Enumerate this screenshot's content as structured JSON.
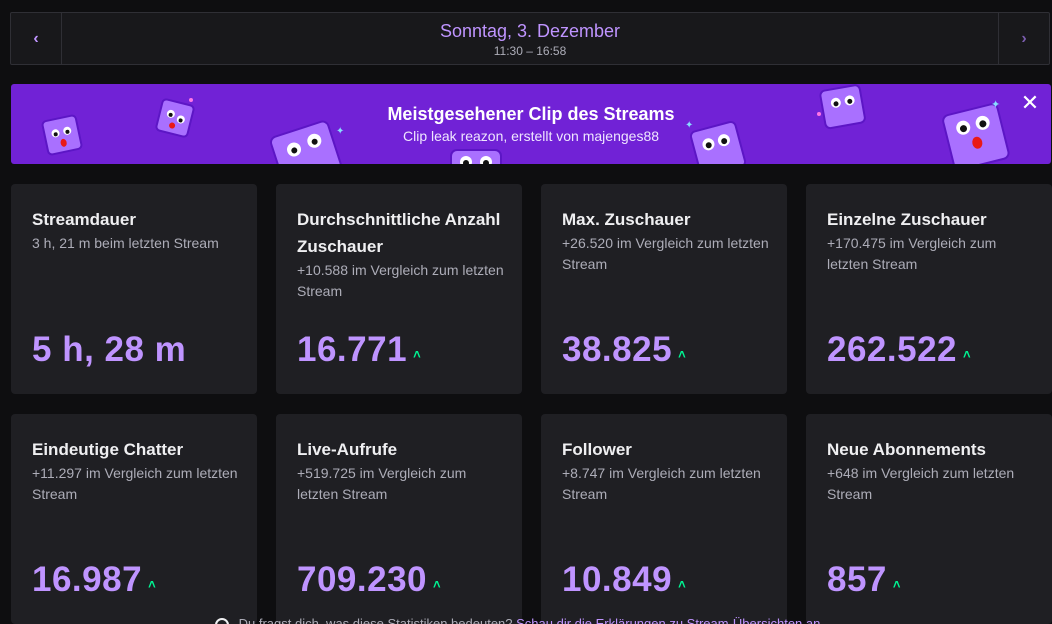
{
  "header": {
    "prev_icon": "chevron-left-icon",
    "next_icon": "chevron-right-icon",
    "prev_glyph": "‹",
    "next_glyph": "›",
    "date": "Sonntag, 3. Dezember",
    "time_range": "11:30 – 16:58"
  },
  "banner": {
    "title": "Meistgesehener Clip des Streams",
    "subtitle": "Clip leak reazon, erstellt von majenges88",
    "close_glyph": "✕",
    "background": "#7122d6"
  },
  "cards": [
    {
      "title": "Streamdauer",
      "subtitle": "3 h, 21 m beim letzten Stream",
      "value": "5 h, 28 m",
      "trend": ""
    },
    {
      "title": "Durchschnittliche Anzahl Zuschauer",
      "subtitle": "+10.588 im Vergleich zum letzten Stream",
      "value": "16.771",
      "trend": "˄"
    },
    {
      "title": "Max. Zuschauer",
      "subtitle": "+26.520 im Vergleich zum letzten Stream",
      "value": "38.825",
      "trend": "˄"
    },
    {
      "title": "Einzelne Zuschauer",
      "subtitle": "+170.475 im Vergleich zum letzten Stream",
      "value": "262.522",
      "trend": "˄"
    },
    {
      "title": "Eindeutige Chatter",
      "subtitle": "+11.297 im Vergleich zum letzten Stream",
      "value": "16.987",
      "trend": "˄"
    },
    {
      "title": "Live-Aufrufe",
      "subtitle": "+519.725 im Vergleich zum letzten Stream",
      "value": "709.230",
      "trend": "˄"
    },
    {
      "title": "Follower",
      "subtitle": "+8.747 im Vergleich zum letzten Stream",
      "value": "10.849",
      "trend": "˄"
    },
    {
      "title": "Neue Abonnements",
      "subtitle": "+648 im Vergleich zum letzten Stream",
      "value": "857",
      "trend": "˄"
    }
  ],
  "colors": {
    "accent": "#bf94ff",
    "trend_up": "#00f593",
    "card_bg": "#1f1f23",
    "page_bg": "#0e0e10"
  },
  "footer": {
    "icon": "question-circle-icon",
    "text": "Du fragst dich, was diese Statistiken bedeuten?",
    "link": "Schau dir die Erklärungen zu Stream-Übersichten an"
  }
}
